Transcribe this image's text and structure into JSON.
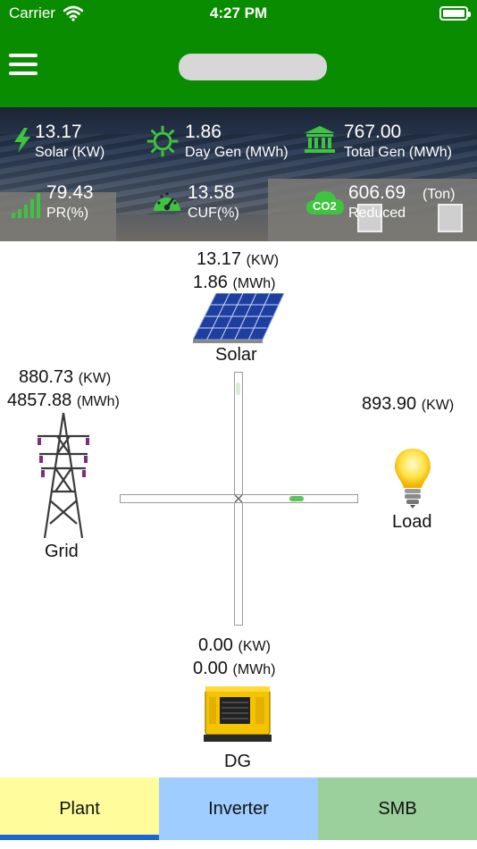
{
  "status_bar": {
    "carrier": "Carrier",
    "time": "4:27 PM"
  },
  "header": {
    "title": ""
  },
  "stats": [
    {
      "value": "13.17",
      "label": "Solar (KW)",
      "icon": "lightning-icon"
    },
    {
      "value": "1.86",
      "label": "Day Gen (MWh)",
      "icon": "sun-icon"
    },
    {
      "value": "767.00",
      "label": "Total Gen (MWh)",
      "icon": "bank-icon"
    },
    {
      "value": "79.43",
      "label": "PR(%)",
      "icon": "signal-bars-icon"
    },
    {
      "value": "13.58",
      "label": "CUF(%)",
      "icon": "gauge-icon"
    },
    {
      "value": "606.69",
      "unit": "(Ton)",
      "label": "Reduced",
      "icon": "co2-cloud-icon",
      "icon_text": "CO2"
    }
  ],
  "diagram": {
    "solar": {
      "kw": "13.17",
      "kw_unit": "(KW)",
      "mwh": "1.86",
      "mwh_unit": "(MWh)",
      "label": "Solar"
    },
    "grid": {
      "kw": "880.73",
      "kw_unit": "(KW)",
      "mwh": "4857.88",
      "mwh_unit": "(MWh)",
      "label": "Grid"
    },
    "load": {
      "kw": "893.90",
      "kw_unit": "(KW)",
      "label": "Load"
    },
    "dg": {
      "kw": "0.00",
      "kw_unit": "(KW)",
      "mwh": "0.00",
      "mwh_unit": "(MWh)",
      "label": "DG"
    }
  },
  "tabs": [
    {
      "label": "Plant",
      "active": true
    },
    {
      "label": "Inverter",
      "active": false
    },
    {
      "label": "SMB",
      "active": false
    }
  ],
  "colors": {
    "header_green": "#0a8c00",
    "icon_green": "#3ec43e",
    "tab_plant": "#fefc9b",
    "tab_inverter": "#9fcdff",
    "tab_smb": "#9bcf9b",
    "tab_indicator": "#1a66d6"
  }
}
